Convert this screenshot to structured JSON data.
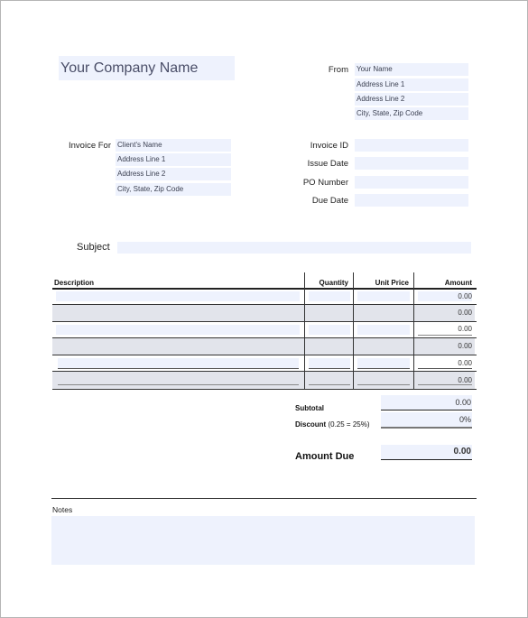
{
  "company": {
    "name": "Your Company Name"
  },
  "from": {
    "label": "From",
    "lines": [
      "Your Name",
      "Address Line 1",
      "Address Line 2",
      "City, State, Zip Code"
    ]
  },
  "invoice_for": {
    "label": "Invoice For",
    "lines": [
      "Client's Name",
      "Address Line 1",
      "Address Line 2",
      "City, State, Zip Code"
    ]
  },
  "meta": {
    "invoice_id_label": "Invoice ID",
    "invoice_id_value": "",
    "issue_date_label": "Issue Date",
    "issue_date_value": "",
    "po_number_label": "PO Number",
    "po_number_value": "",
    "due_date_label": "Due Date",
    "due_date_value": ""
  },
  "subject": {
    "label": "Subject",
    "value": ""
  },
  "table": {
    "headers": [
      "Description",
      "Quantity",
      "Unit Price",
      "Amount"
    ],
    "rows": [
      {
        "description": "",
        "quantity": "",
        "unit_price": "",
        "amount": "0.00"
      },
      {
        "description": "",
        "quantity": "",
        "unit_price": "",
        "amount": "0.00"
      },
      {
        "description": "",
        "quantity": "",
        "unit_price": "",
        "amount": "0.00"
      },
      {
        "description": "",
        "quantity": "",
        "unit_price": "",
        "amount": "0.00"
      },
      {
        "description": "",
        "quantity": "",
        "unit_price": "",
        "amount": "0.00"
      },
      {
        "description": "",
        "quantity": "",
        "unit_price": "",
        "amount": "0.00"
      }
    ]
  },
  "totals": {
    "subtotal_label": "Subtotal",
    "subtotal_value": "0.00",
    "discount_label": "Discount",
    "discount_hint": "(0.25 = 25%)",
    "discount_value": "0%",
    "amount_due_label": "Amount Due",
    "amount_due_value": "0.00"
  },
  "notes": {
    "label": "Notes",
    "value": ""
  },
  "colors": {
    "field_bg": "#eef2fd",
    "row_grey": "#e2e4eb",
    "text_field": "#4a4e68"
  }
}
